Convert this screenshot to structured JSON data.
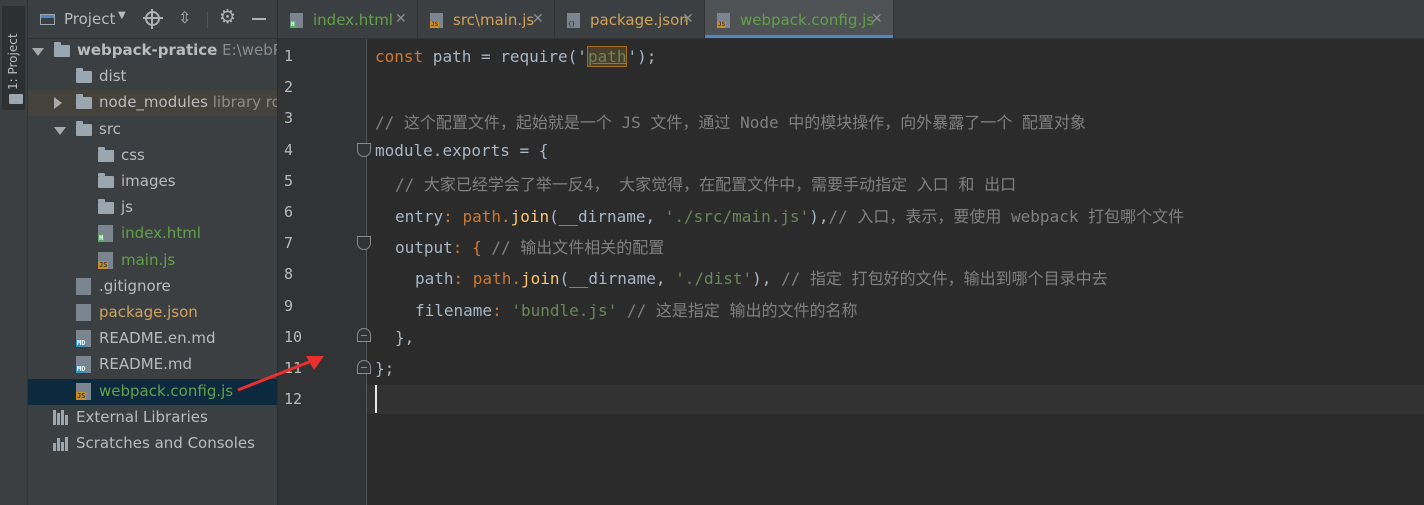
{
  "strip": {
    "label": "1: Project"
  },
  "panel": {
    "title": "Project",
    "tree": [
      {
        "label": "webpack-pratice",
        "extra": "E:\\webPro",
        "type": "folder",
        "depth": 0,
        "expanded": true,
        "bold": true
      },
      {
        "label": "dist",
        "type": "folder",
        "depth": 1
      },
      {
        "label": "node_modules",
        "extra": "library ro",
        "type": "folder",
        "depth": 1,
        "collapsed": true
      },
      {
        "label": "src",
        "type": "folder",
        "depth": 1,
        "expanded": true
      },
      {
        "label": "css",
        "type": "folder",
        "depth": 2
      },
      {
        "label": "images",
        "type": "folder",
        "depth": 2
      },
      {
        "label": "js",
        "type": "folder",
        "depth": 2
      },
      {
        "label": "index.html",
        "type": "html",
        "depth": 2
      },
      {
        "label": "main.js",
        "type": "js",
        "depth": 2
      },
      {
        "label": ".gitignore",
        "type": "git",
        "depth": 1
      },
      {
        "label": "package.json",
        "type": "json",
        "depth": 1
      },
      {
        "label": "README.en.md",
        "type": "md",
        "depth": 1
      },
      {
        "label": "README.md",
        "type": "md",
        "depth": 1
      },
      {
        "label": "webpack.config.js",
        "type": "js",
        "depth": 1,
        "selected": true
      }
    ],
    "external": "External Libraries",
    "scratches": "Scratches and Consoles"
  },
  "tabs": [
    {
      "label": "index.html",
      "icon": "html",
      "badge": "H"
    },
    {
      "label": "src\\main.js",
      "icon": "js",
      "badge": "JS"
    },
    {
      "label": "package.json",
      "icon": "json",
      "badge": "{}"
    },
    {
      "label": "webpack.config.js",
      "icon": "js",
      "badge": "JS",
      "active": true
    }
  ],
  "editor": {
    "line_numbers": [
      "1",
      "2",
      "3",
      "4",
      "5",
      "6",
      "7",
      "8",
      "9",
      "10",
      "11",
      "12"
    ],
    "code": {
      "l1_kw": "const",
      "l1_a": " path = require('",
      "l1_str": "path",
      "l1_b": "');",
      "l3": "// 这个配置文件，起始就是一个 JS 文件，通过 Node 中的模块操作，向外暴露了一个 配置对象",
      "l4_a": "module.",
      "l4_b": "exports",
      "l4_c": " = {",
      "l5": "// 大家已经学会了举一反4， 大家觉得，在配置文件中，需要手动指定 入口 和 出口",
      "l6_key": "entry",
      "l6_a": ": path.",
      "l6_fn": "join",
      "l6_b": "(__dirname, ",
      "l6_str": "'./src/main.js'",
      "l6_c": "),",
      "l6_cm": "// 入口，表示，要使用 webpack 打包哪个文件",
      "l7_key": "output",
      "l7_a": ": { ",
      "l7_cm": "// 输出文件相关的配置",
      "l8_key": "path",
      "l8_a": ": path.",
      "l8_fn": "join",
      "l8_b": "(__dirname, ",
      "l8_str": "'./dist'",
      "l8_c": "), ",
      "l8_cm": "// 指定 打包好的文件，输出到哪个目录中去",
      "l9_key": "filename",
      "l9_a": ": ",
      "l9_str": "'bundle.js'",
      "l9_cm": " // 这是指定 输出的文件的名称",
      "l10": "},",
      "l11": "};"
    }
  },
  "colors": {
    "keyword": "#cc7832",
    "string": "#6a8759",
    "comment": "#808080",
    "function": "#ffc66d",
    "arrow": "#e8312f"
  }
}
